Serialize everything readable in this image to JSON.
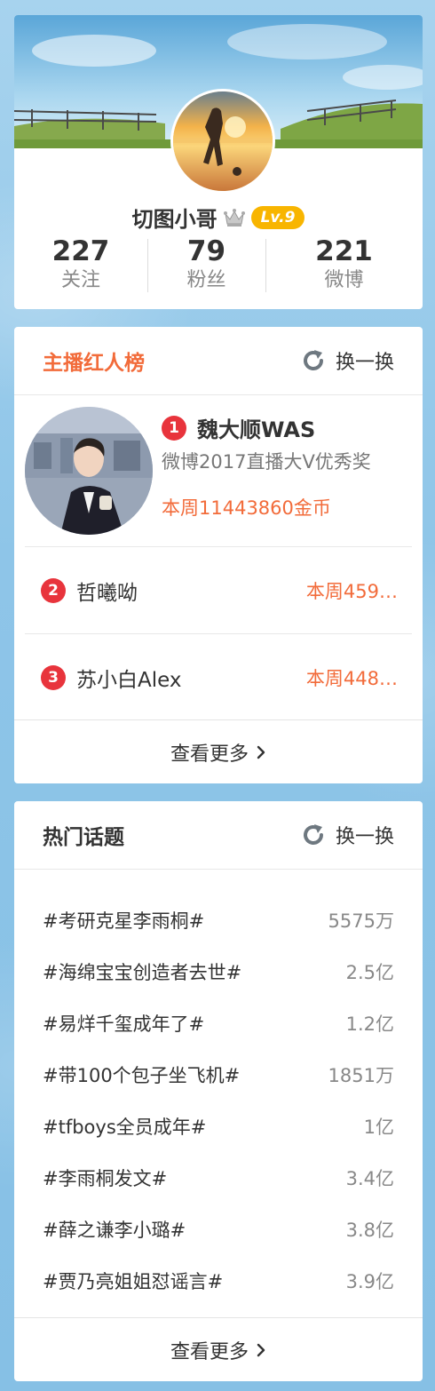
{
  "profile": {
    "username": "切图小哥",
    "level": "Lv.9",
    "stats": [
      {
        "value": "227",
        "label": "关注"
      },
      {
        "value": "79",
        "label": "粉丝"
      },
      {
        "value": "221",
        "label": "微博"
      }
    ]
  },
  "ranking": {
    "title": "主播红人榜",
    "refresh_label": "换一换",
    "top": {
      "rank": "1",
      "name": "魏大顺WAS",
      "award": "微博2017直播大V优秀奖",
      "coins": "本周11443860金币"
    },
    "items": [
      {
        "rank": "2",
        "name": "哲曦呦",
        "coins": "本周459…"
      },
      {
        "rank": "3",
        "name": "苏小白Alex",
        "coins": "本周448…"
      }
    ],
    "more_label": "查看更多"
  },
  "topics": {
    "title": "热门话题",
    "refresh_label": "换一换",
    "items": [
      {
        "name": "#考研克星李雨桐#",
        "count": "5575万"
      },
      {
        "name": "#海绵宝宝创造者去世#",
        "count": "2.5亿"
      },
      {
        "name": "#易烊千玺成年了#",
        "count": "1.2亿"
      },
      {
        "name": "#带100个包子坐飞机#",
        "count": "1851万"
      },
      {
        "name": "#tfboys全员成年#",
        "count": "1亿"
      },
      {
        "name": "#李雨桐发文#",
        "count": "3.4亿"
      },
      {
        "name": "#薛之谦李小璐#",
        "count": "3.8亿"
      },
      {
        "name": "#贾乃亮姐姐怼谣言#",
        "count": "3.9亿"
      }
    ],
    "more_label": "查看更多"
  },
  "colors": {
    "accent": "#f26b3a",
    "rank_badge": "#e8343c",
    "level_badge": "#f8b500",
    "page_bg": "#8fc4e6"
  },
  "icons": [
    "crown-icon",
    "refresh-icon",
    "chevron-right-icon"
  ]
}
